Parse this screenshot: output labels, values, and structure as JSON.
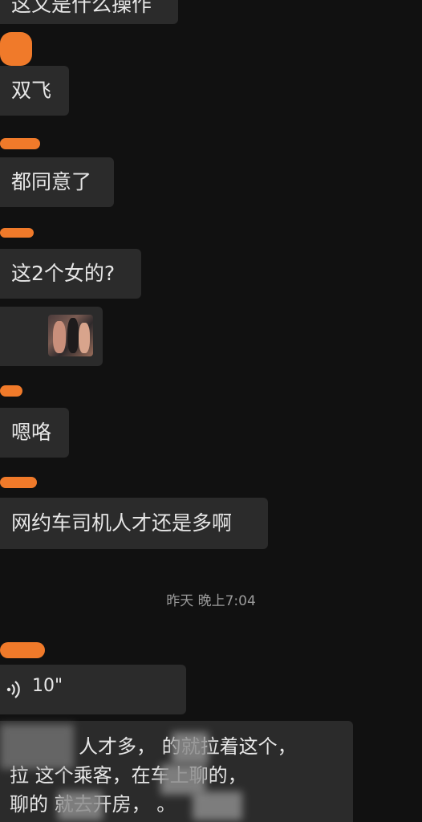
{
  "messages": {
    "m0": "这又是什么操作",
    "m1": "双飞",
    "m2": "都同意了",
    "m3": "这2个女的?",
    "m4": "嗯咯",
    "m5": "网约车司机人才还是多啊"
  },
  "timestamp": "昨天 晚上7:04",
  "voice": {
    "duration": "10\"",
    "icon": "voice-wave-icon"
  },
  "long_message": {
    "line1": "人才多，  的就拉着这个，",
    "line2": "拉  这个乘客，在车上聊的，",
    "line3": "聊的  就去开房，  。"
  },
  "colors": {
    "background": "#111111",
    "bubble": "#2b2b2b",
    "redaction": "#f07a2a"
  }
}
